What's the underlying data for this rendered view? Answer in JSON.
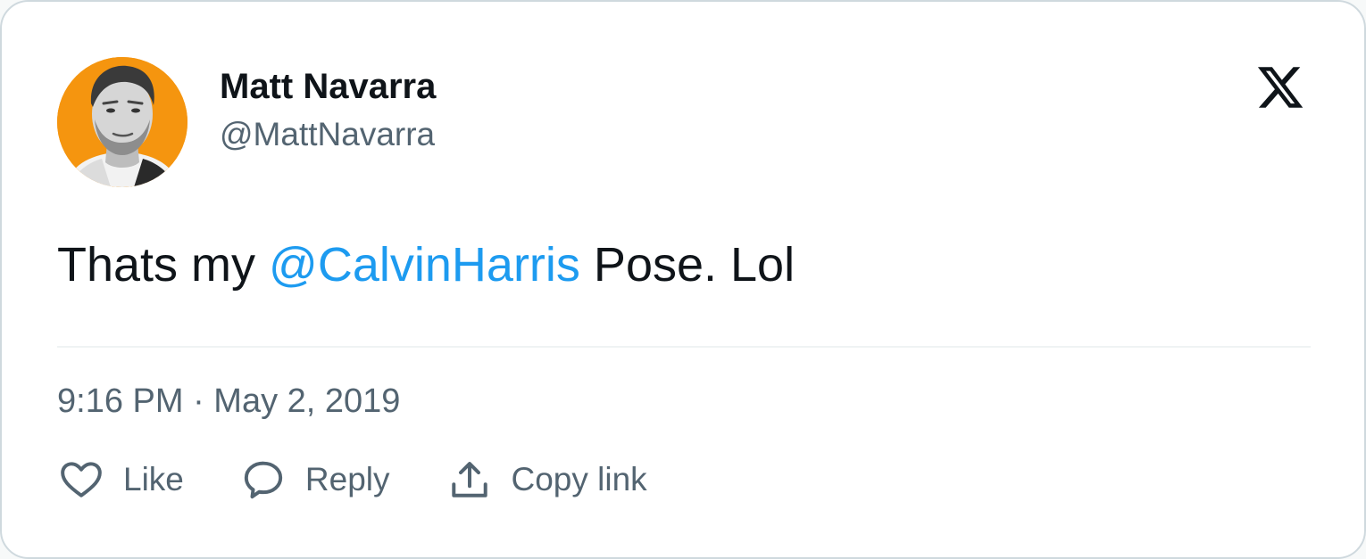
{
  "author": {
    "display_name": "Matt Navarra",
    "handle": "@MattNavarra",
    "avatar_background": "#f5950f"
  },
  "brand": {
    "logo_icon": "x-logo-icon"
  },
  "tweet": {
    "text_before": "Thats my ",
    "mention": "@CalvinHarris",
    "text_after": " Pose. Lol",
    "mention_color": "#1d9bf0"
  },
  "timestamp": "9:16 PM · May 2, 2019",
  "actions": [
    {
      "label": "Like",
      "icon": "heart-icon"
    },
    {
      "label": "Reply",
      "icon": "speech-bubble-icon"
    },
    {
      "label": "Copy link",
      "icon": "share-upload-icon"
    }
  ]
}
